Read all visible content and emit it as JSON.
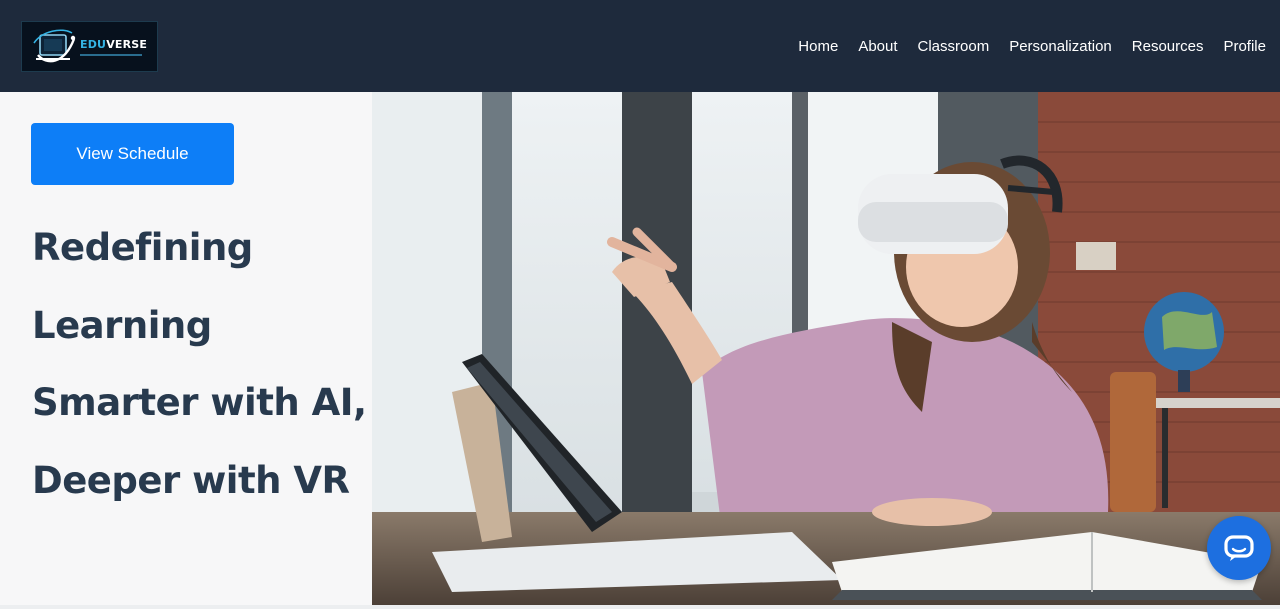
{
  "header": {
    "logo": {
      "brand_primary": "EDU",
      "brand_secondary": "VERSE",
      "accent_color": "#34b3e4"
    },
    "nav": [
      {
        "label": "Home"
      },
      {
        "label": "About"
      },
      {
        "label": "Classroom"
      },
      {
        "label": "Personalization"
      },
      {
        "label": "Resources"
      },
      {
        "label": "Profile"
      }
    ],
    "background_color": "#1e2a3c"
  },
  "hero": {
    "cta_label": "View Schedule",
    "cta_color": "#0d7ef7",
    "headline_lines": [
      "Redefining",
      "Learning",
      "Smarter with AI,",
      "Deeper with VR"
    ],
    "headline_color": "#283a4e",
    "image": {
      "subject": "child-wearing-vr-headset-at-desk"
    }
  },
  "chat": {
    "icon": "chat-bubble-icon",
    "color": "#1d6fe0"
  }
}
